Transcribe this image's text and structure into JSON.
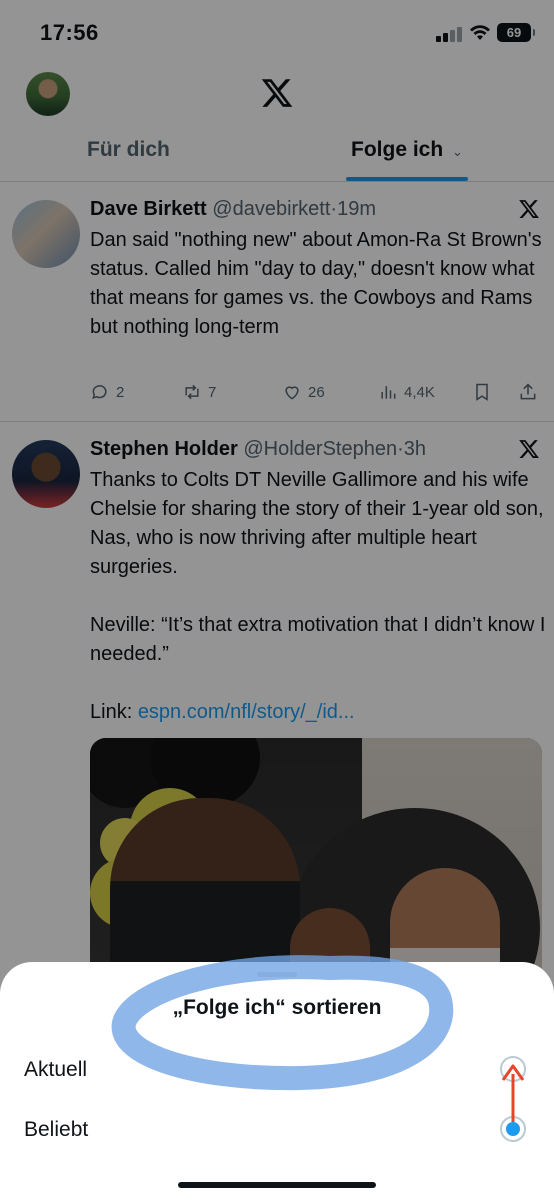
{
  "status_bar": {
    "time": "17:56",
    "battery": "69"
  },
  "tabs": [
    {
      "label": "Für dich",
      "active": false
    },
    {
      "label": "Folge ich",
      "active": true
    }
  ],
  "tweets": [
    {
      "name": "Dave Birkett",
      "handle": "@davebirkett",
      "separator": "·",
      "time": "19m",
      "text": "Dan said \"nothing new\" about Amon-Ra St Brown's status. Called him \"day to day,\" doesn't know what that means for games vs. the Cowboys and Rams but nothing long-term",
      "replies": "2",
      "reposts": "7",
      "likes": "26",
      "views": "4,4K"
    },
    {
      "name": "Stephen Holder",
      "handle": "@HolderStephen",
      "separator": "·",
      "time": "3h",
      "text": "Thanks to Colts DT Neville Gallimore and his wife Chelsie for sharing the story of their 1-year old son, Nas, who is now thriving after multiple heart surgeries.",
      "text2": "Neville: “It’s that extra motivation that I didn’t know I needed.”",
      "link_prefix": "Link: ",
      "link": "espn.com/nfl/story/_/id..."
    }
  ],
  "sheet": {
    "title": "„Folge ich“ sortieren",
    "options": [
      {
        "label": "Aktuell",
        "selected": false
      },
      {
        "label": "Beliebt",
        "selected": true
      }
    ]
  },
  "colors": {
    "accent": "#1d9bf0",
    "annotation_highlight": "#6fa3e3",
    "annotation_arrow": "#e8452c"
  },
  "icons": [
    "x-logo-icon",
    "reply-icon",
    "repost-icon",
    "like-icon",
    "views-icon",
    "bookmark-icon",
    "share-icon",
    "chevron-down-icon",
    "signal-icon",
    "wifi-icon",
    "battery-icon"
  ]
}
